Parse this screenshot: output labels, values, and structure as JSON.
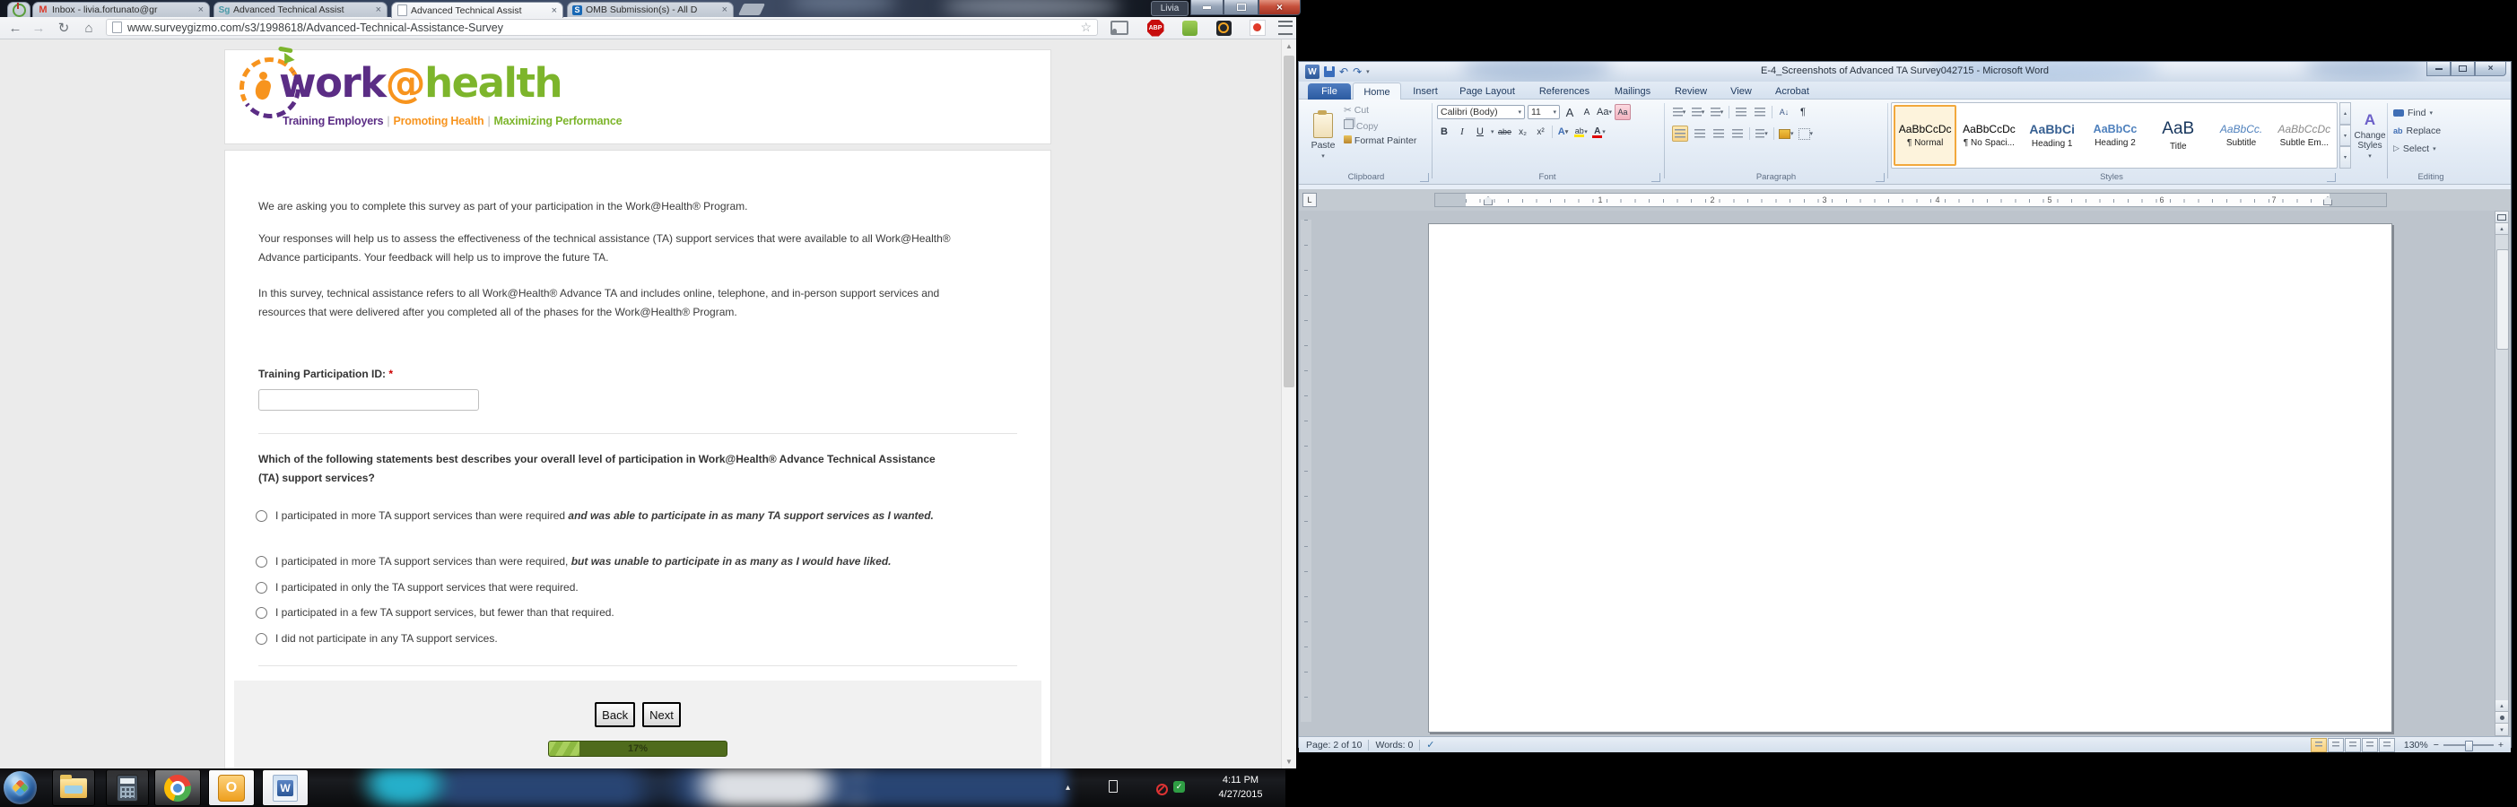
{
  "browser": {
    "profile_label": "Livia",
    "url": "www.surveygizmo.com/s3/1998618/Advanced-Technical-Assistance-Survey",
    "tabs": [
      {
        "label": ""
      },
      {
        "label": "Inbox - livia.fortunato@gr"
      },
      {
        "label": "Advanced Technical Assist"
      },
      {
        "label": "Advanced Technical Assist"
      },
      {
        "label": "OMB Submission(s) - All D"
      }
    ]
  },
  "survey": {
    "intro": [
      "We are asking you to complete this survey as part of your participation in the Work@Health® Program.",
      "Your responses will help us to assess the effectiveness of the technical assistance (TA) support services that were available to all Work@Health® Advance participants. Your feedback will help us to improve the future TA.",
      "In this survey, technical assistance refers to all Work@Health® Advance TA and includes online, telephone, and in-person support services and resources that were delivered after you completed all of the phases for the Work@Health® Program."
    ],
    "id_label": "Training Participation ID:",
    "required_marker": "*",
    "id_value": "",
    "question": "Which of the following statements best describes your overall level of participation in Work@Health® Advance Technical Assistance (TA) support services?",
    "options": [
      {
        "normal": "I participated in more TA support services than were required ",
        "emphasis": "and was able to participate in as many TA support services as I wanted."
      },
      {
        "normal": "I participated in more TA support services than were required, ",
        "emphasis": "but was unable to participate in as many as I would have liked."
      },
      {
        "normal": "I participated in only the TA support services that were required.",
        "emphasis": ""
      },
      {
        "normal": "I participated in a few TA support services, but fewer than that required.",
        "emphasis": ""
      },
      {
        "normal": "I did not participate in any TA support services.",
        "emphasis": ""
      }
    ],
    "back_label": "Back",
    "next_label": "Next",
    "progress": {
      "label": "17%"
    },
    "logo": {
      "word1": "work",
      "at": "@",
      "word2": "health",
      "tagline": [
        "Training Employers",
        "Promoting Health",
        "Maximizing Performance"
      ],
      "tagline_separator": "|"
    },
    "colors": {
      "purple": "#5b2d85",
      "orange": "#f7941e",
      "green": "#7db52c",
      "progress_track": "#4f6b1c",
      "progress_fill": "#97c04e"
    }
  },
  "word": {
    "title": "E-4_Screenshots of Advanced TA Survey042715 - Microsoft Word",
    "tabs": [
      "File",
      "Home",
      "Insert",
      "Page Layout",
      "References",
      "Mailings",
      "Review",
      "View",
      "Acrobat"
    ],
    "clipboard": {
      "paste": "Paste",
      "cut": "Cut",
      "copy": "Copy",
      "format_painter": "Format Painter",
      "label": "Clipboard"
    },
    "font": {
      "family": "Calibri (Body)",
      "size": "11",
      "label": "Font"
    },
    "paragraph": {
      "label": "Paragraph"
    },
    "styles": {
      "label": "Styles",
      "change": "Change Styles",
      "items": [
        {
          "sample": "AaBbCcDc",
          "name": "¶ Normal"
        },
        {
          "sample": "AaBbCcDc",
          "name": "¶ No Spaci..."
        },
        {
          "sample": "AaBbCi",
          "name": "Heading 1"
        },
        {
          "sample": "AaBbCc",
          "name": "Heading 2"
        },
        {
          "sample": "AaB",
          "name": "Title"
        },
        {
          "sample": "AaBbCc.",
          "name": "Subtitle"
        },
        {
          "sample": "AaBbCcDc",
          "name": "Subtle Em..."
        }
      ]
    },
    "editing": {
      "label": "Editing",
      "find": "Find",
      "replace": "Replace",
      "select": "Select"
    },
    "ruler_numbers": [
      "1",
      "2",
      "3",
      "4",
      "5",
      "6",
      "7"
    ],
    "status": {
      "page": "Page: 2 of 10",
      "words": "Words: 0",
      "zoom": "130%"
    }
  },
  "taskbar": {
    "time": "4:11 PM",
    "date": "4/27/2015"
  },
  "icons": {
    "gmail": "M",
    "surveygizmo": "Sg",
    "sharepoint": "S",
    "tab_close": "×",
    "nav_back": "←",
    "nav_forward": "→",
    "nav_reload": "↻",
    "nav_home": "⌂",
    "bookmark_star": "☆",
    "abp": "ABP",
    "dropdown": "▾",
    "undo": "↶",
    "redo": "↷",
    "word_logo": "W",
    "cut": "✂",
    "copy_glyph": "⧉",
    "pilcrow": "¶",
    "bold": "B",
    "italic": "I",
    "underline": "U",
    "strike": "abe",
    "subscript": "x₂",
    "superscript": "x²",
    "grow_font": "A",
    "shrink_font": "A",
    "change_case": "Aa",
    "text_effects": "A",
    "highlight": "ab",
    "font_color": "A",
    "sort": "A↓",
    "tab_stop": "L",
    "spell_check": "✓",
    "change_styles_a": "A",
    "select_arrow": "▷",
    "zoom_minus": "−",
    "zoom_plus": "+",
    "up_arrow": "▴",
    "down_arrow": "▾",
    "scroll_up": "▲",
    "scroll_dn": "▼"
  }
}
